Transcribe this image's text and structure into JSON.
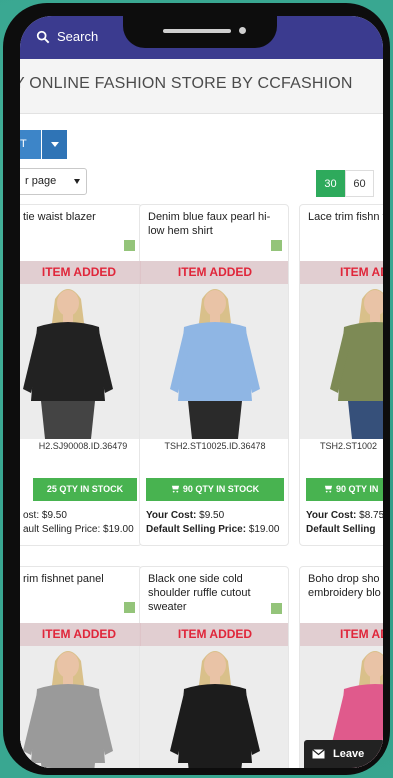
{
  "topbar": {
    "search_label": "Search"
  },
  "store_title": "Y ONLINE FASHION STORE BY CCFASHION",
  "select_button": {
    "label": "CT"
  },
  "per_page": {
    "label": "r page"
  },
  "pager": {
    "pages": [
      "30",
      "60"
    ],
    "active": "30"
  },
  "products": [
    {
      "name": "tie waist blazer",
      "added": "ITEM ADDED",
      "sku": "H2.SJ90008.ID.36479",
      "stock": "25 QTY IN STOCK",
      "cost": "ost: $9.50",
      "dsp": "ault Selling Price: $19.00",
      "top_color": "#222222",
      "bottom_color": "#444444"
    },
    {
      "name": "Denim blue faux pearl hi-low hem shirt",
      "added": "ITEM ADDED",
      "sku": "TSH2.ST10025.ID.36478",
      "stock": "90 QTY IN STOCK",
      "cost_label": "Your Cost:",
      "cost_value": "$9.50",
      "dsp_label": "Default Selling Price:",
      "dsp_value": "$19.00",
      "top_color": "#8fb6e4",
      "bottom_color": "#2a2a2a"
    },
    {
      "name": "Lace trim fishn top",
      "added": "ITEM AD",
      "sku": "TSH2.ST1002",
      "stock": "90 QTY IN",
      "cost_label": "Your Cost:",
      "cost_value": "$8.75",
      "dsp_label": "Default Selling",
      "dsp_value": "",
      "top_color": "#7d8a55",
      "bottom_color": "#36507a"
    },
    {
      "name": "rim fishnet panel",
      "added": "ITEM ADDED",
      "top_color": "#9a9a9a",
      "bottom_color": "#9a9a9a"
    },
    {
      "name": "Black one side cold shoulder ruffle cutout sweater",
      "added": "ITEM ADDED",
      "top_color": "#1c1c1c",
      "bottom_color": "#1c1c1c"
    },
    {
      "name": "Boho drop sho embroidery blo",
      "added": "ITEM AD",
      "top_color": "#e05a8c",
      "bottom_color": "#e05a8c"
    }
  ],
  "leave_label": "Leave"
}
